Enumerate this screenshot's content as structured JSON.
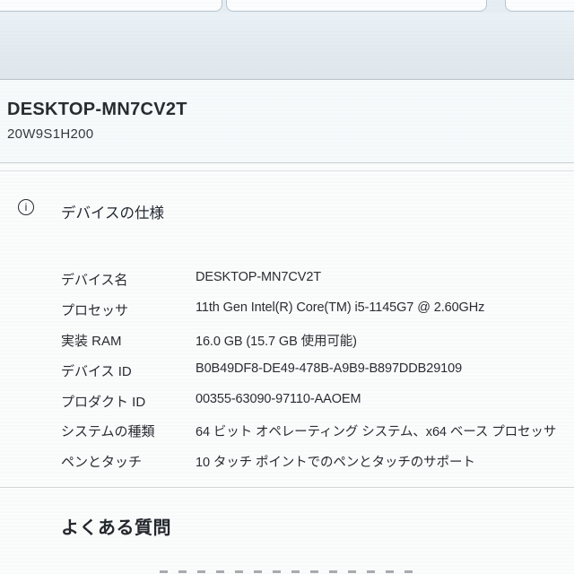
{
  "page": {
    "device_header": {
      "device_name": "DESKTOP-MN7CV2T",
      "serial_number": "20W9S1H200"
    },
    "device_specs": {
      "icon": "info-circle-icon",
      "icon_glyph": "i",
      "title": "デバイスの仕様",
      "rows": [
        {
          "label": "デバイス名",
          "value": "DESKTOP-MN7CV2T"
        },
        {
          "label": "プロセッサ",
          "value": "11th Gen Intel(R) Core(TM) i5-1145G7 @ 2.60GHz"
        },
        {
          "label": "実装 RAM",
          "value": "16.0 GB (15.7 GB 使用可能)"
        },
        {
          "label": "デバイス ID",
          "value": "B0B49DF8-DE49-478B-A9B9-B897DDB29109"
        },
        {
          "label": "プロダクト ID",
          "value": "00355-63090-97110-AAOEM"
        },
        {
          "label": "システムの種類",
          "value": "64 ビット オペレーティング システム、x64 ベース プロセッサ"
        },
        {
          "label": "ペンとタッチ",
          "value": "10 タッチ ポイントでのペンとタッチのサポート"
        }
      ]
    },
    "faq": {
      "title": "よくある質問"
    }
  },
  "colors": {
    "band_blue": "#e3ebf0",
    "card_outline": "#b9c5cd",
    "header_bg": "#f6fafb",
    "text_primary": "#26292d",
    "divider": "#c8cfd4"
  }
}
